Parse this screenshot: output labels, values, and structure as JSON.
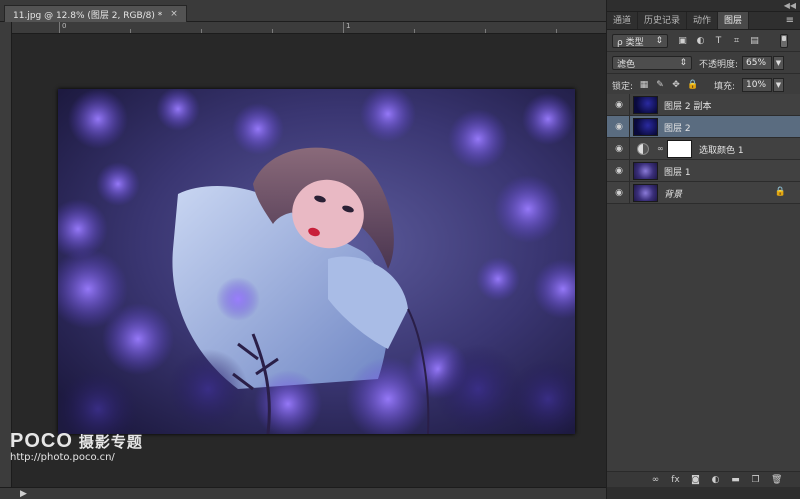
{
  "document": {
    "tab_title": "11.jpg @ 12.8% (图层 2, RGB/8) *",
    "close_glyph": "×",
    "ruler_top_numbers": [
      "0",
      "1"
    ],
    "status_arrow": "▶"
  },
  "watermark": {
    "brand": "POCO",
    "subtitle": "摄影专题",
    "url": "http://photo.poco.cn/"
  },
  "panel": {
    "tabs": [
      {
        "label": "通道",
        "active": false
      },
      {
        "label": "历史记录",
        "active": false
      },
      {
        "label": "动作",
        "active": false
      },
      {
        "label": "图层",
        "active": true
      }
    ],
    "menu_glyph": "≡",
    "collapse_glyph": "◀◀",
    "filter": {
      "label": "ρ 类型",
      "arrow": "⇕"
    },
    "blend": {
      "mode": "滤色",
      "arrow": "⇕",
      "opacity_label": "不透明度:",
      "opacity_value": "65%",
      "arrow_down": "▼"
    },
    "lock": {
      "label": "锁定:",
      "fill_label": "填充:",
      "fill_value": "10%",
      "arrow_down": "▼"
    },
    "layers": [
      {
        "name": "图层 2 副本",
        "type": "dark",
        "selected": false
      },
      {
        "name": "图层 2",
        "type": "dark",
        "selected": true
      },
      {
        "name": "选取颜色 1",
        "type": "adjustment",
        "selected": false
      },
      {
        "name": "图层 1",
        "type": "photo",
        "selected": false
      },
      {
        "name": "背景",
        "type": "background",
        "selected": false,
        "locked": true
      }
    ],
    "bottom_icons": [
      "link-icon",
      "fx-icon",
      "mask-icon",
      "adjustment-icon",
      "folder-icon",
      "new-layer-icon",
      "trash-icon"
    ]
  }
}
